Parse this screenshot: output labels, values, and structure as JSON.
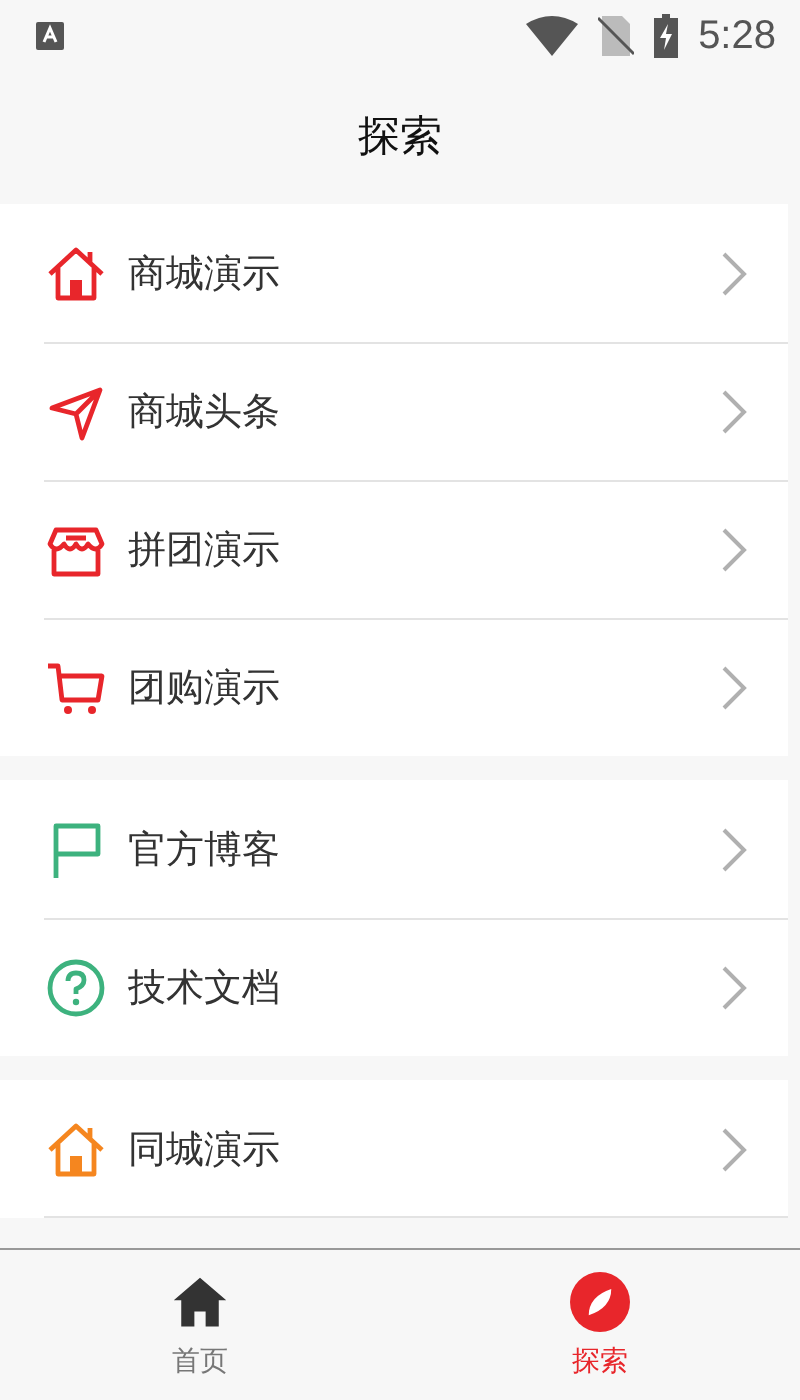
{
  "status_bar": {
    "time": "5:28"
  },
  "header": {
    "title": "探索"
  },
  "groups": [
    {
      "items": [
        {
          "label": "商城演示",
          "kind": "house",
          "color": "#e8262b"
        },
        {
          "label": "商城头条",
          "kind": "send",
          "color": "#e8262b"
        },
        {
          "label": "拼团演示",
          "kind": "shop",
          "color": "#e8262b"
        },
        {
          "label": "团购演示",
          "kind": "cart",
          "color": "#e8262b"
        }
      ]
    },
    {
      "items": [
        {
          "label": "官方博客",
          "kind": "flag",
          "color": "#3db27e"
        },
        {
          "label": "技术文档",
          "kind": "help",
          "color": "#3db27e"
        }
      ]
    },
    {
      "items": [
        {
          "label": "同城演示",
          "kind": "house",
          "color": "#f5861f"
        }
      ]
    }
  ],
  "tab_bar": [
    {
      "label": "首页",
      "kind": "home",
      "selected": false
    },
    {
      "label": "探索",
      "kind": "compass",
      "selected": true
    }
  ]
}
